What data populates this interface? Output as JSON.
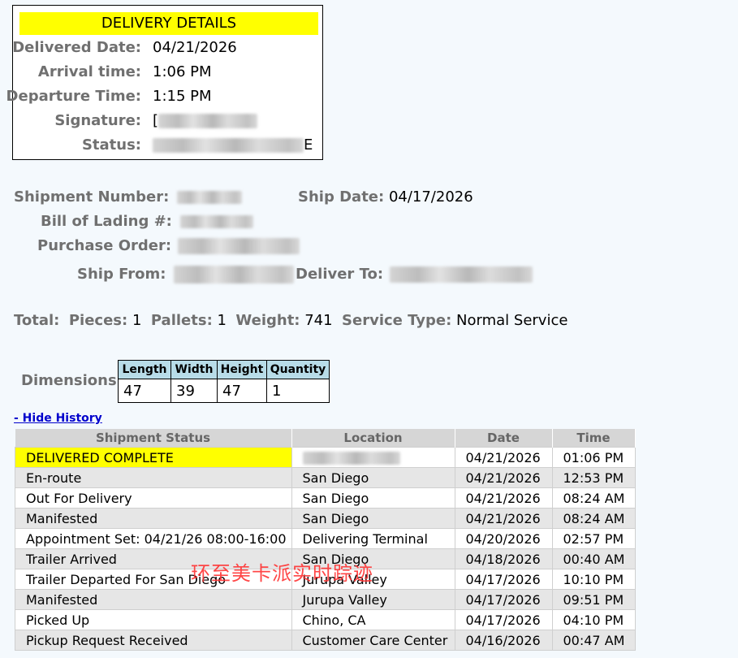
{
  "details": {
    "header": "DELIVERY DETAILS",
    "rows": [
      {
        "label": "Delivered Date:",
        "value": "04/21/2026"
      },
      {
        "label": "Arrival time:",
        "value": "1:06 PM"
      },
      {
        "label": "Departure Time:",
        "value": "1:15 PM"
      },
      {
        "label": "Signature:",
        "value": "["
      },
      {
        "label": "Status:",
        "value": "E"
      }
    ]
  },
  "shipment": {
    "shipment_number_label": "Shipment Number:",
    "ship_date_label": "Ship Date:",
    "ship_date": "04/17/2026",
    "bol_label": "Bill of Lading #:",
    "po_label": "Purchase Order:",
    "ship_from_label": "Ship From:",
    "deliver_to_label": "Deliver To:"
  },
  "totals": {
    "total_label": "Total:",
    "pieces_label": "Pieces:",
    "pieces": "1",
    "pallets_label": "Pallets:",
    "pallets": "1",
    "weight_label": "Weight:",
    "weight": "741",
    "service_label": "Service Type:",
    "service": "Normal Service"
  },
  "dimensions": {
    "label": "Dimensions:",
    "headers": [
      "Length",
      "Width",
      "Height",
      "Quantity"
    ],
    "values": [
      "47",
      "39",
      "47",
      "1"
    ]
  },
  "hide_history": "- Hide History",
  "history": {
    "headers": [
      "Shipment Status",
      "Location",
      "Date",
      "Time"
    ],
    "rows": [
      {
        "status": "DELIVERED COMPLETE",
        "location": "",
        "date": "04/21/2026",
        "time": "01:06 PM"
      },
      {
        "status": "En-route",
        "location": "San Diego",
        "date": "04/21/2026",
        "time": "12:53 PM"
      },
      {
        "status": "Out For Delivery",
        "location": "San Diego",
        "date": "04/21/2026",
        "time": "08:24 AM"
      },
      {
        "status": "Manifested",
        "location": "San Diego",
        "date": "04/21/2026",
        "time": "08:24 AM"
      },
      {
        "status": "Appointment Set: 04/21/26 08:00-16:00",
        "location": "Delivering Terminal",
        "date": "04/20/2026",
        "time": "02:57 PM"
      },
      {
        "status": "Trailer Arrived",
        "location": "San Diego",
        "date": "04/18/2026",
        "time": "00:40 AM"
      },
      {
        "status": "Trailer Departed For San Diego",
        "location": "Jurupa Valley",
        "date": "04/17/2026",
        "time": "10:10 PM"
      },
      {
        "status": "Manifested",
        "location": "Jurupa Valley",
        "date": "04/17/2026",
        "time": "09:51 PM"
      },
      {
        "status": "Picked Up",
        "location": "Chino, CA",
        "date": "04/17/2026",
        "time": "04:10 PM"
      },
      {
        "status": "Pickup Request Received",
        "location": "Customer Care Center",
        "date": "04/16/2026",
        "time": "00:47 AM"
      }
    ]
  },
  "watermark": "环至美卡派实时踪迹"
}
